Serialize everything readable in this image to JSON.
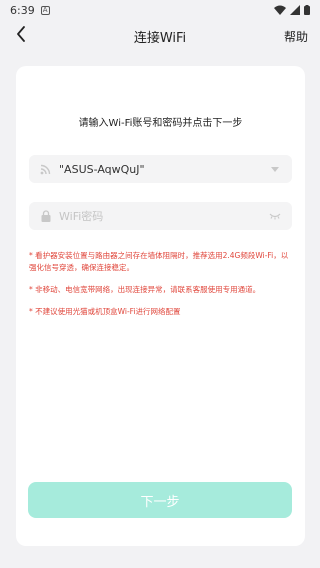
{
  "status_bar": {
    "time": "6:39",
    "app_badge": "A"
  },
  "nav": {
    "title": "连接WiFi",
    "help": "帮助"
  },
  "card": {
    "instruction": "请输入Wi-Fi账号和密码并点击下一步",
    "ssid_value": "\"ASUS-AqwQuJ\"",
    "password_placeholder": "WiFi密码",
    "notes": [
      "* 看护器安装位置与路由器之间存在墙体阻隔时，推荐选用2.4G频段Wi-Fi，以强化信号穿透，确保连接稳定。",
      "* 非移动、电信宽带网络，出现连接异常，请联系客服使用专用通道。",
      "* 不建议使用光猫或机顶盒Wi-Fi进行网络配置"
    ],
    "next_label": "下一步"
  },
  "colors": {
    "note_red": "#e0463b",
    "button_teal": "#a6ebdc",
    "background": "#f2f2f4"
  }
}
